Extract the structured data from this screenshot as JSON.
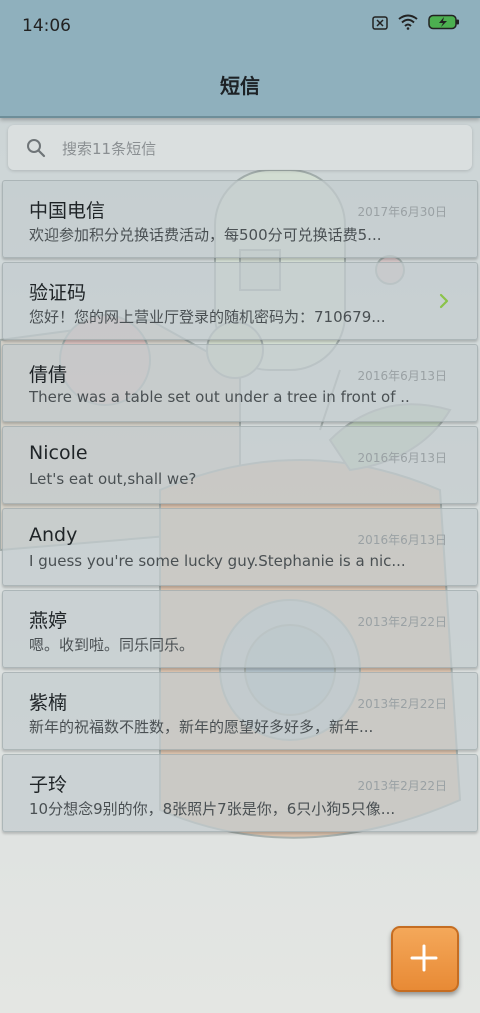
{
  "status_bar": {
    "time": "14:06"
  },
  "header": {
    "title": "短信"
  },
  "search": {
    "placeholder": "搜索11条短信"
  },
  "messages": [
    {
      "name": "中国电信",
      "date": "2017年6月30日",
      "preview": "欢迎参加积分兑换话费活动，每500分可兑换话费5..."
    },
    {
      "name": "验证码",
      "date": "",
      "preview": "您好！您的网上营业厅登录的随机密码为：710679..."
    },
    {
      "name": "倩倩",
      "date": "2016年6月13日",
      "preview": "There was a table set out under a tree in front of ..."
    },
    {
      "name": "Nicole",
      "date": "2016年6月13日",
      "preview": "Let's eat out,shall we?"
    },
    {
      "name": "Andy",
      "date": "2016年6月13日",
      "preview": "I guess you're some lucky guy.Stephanie is a nic..."
    },
    {
      "name": "燕婷",
      "date": "2013年2月22日",
      "preview": "嗯。收到啦。同乐同乐。"
    },
    {
      "name": "紫楠",
      "date": "2013年2月22日",
      "preview": "新年的祝福数不胜数，新年的愿望好多好多，新年..."
    },
    {
      "name": "子玲",
      "date": "2013年2月22日",
      "preview": "10分想念9别的你，8张照片7张是你，6只小狗5只像..."
    }
  ],
  "icons": {
    "search": "search-icon",
    "chevron": "chevron-right-icon",
    "compose": "plus-icon",
    "battery": "battery-charging-icon",
    "wifi": "wifi-icon",
    "sim": "no-sim-icon"
  },
  "colors": {
    "header": "#8fb0bd",
    "fab": "#e88a35",
    "chevron": "#8bc34a",
    "battery": "#4caf50"
  }
}
